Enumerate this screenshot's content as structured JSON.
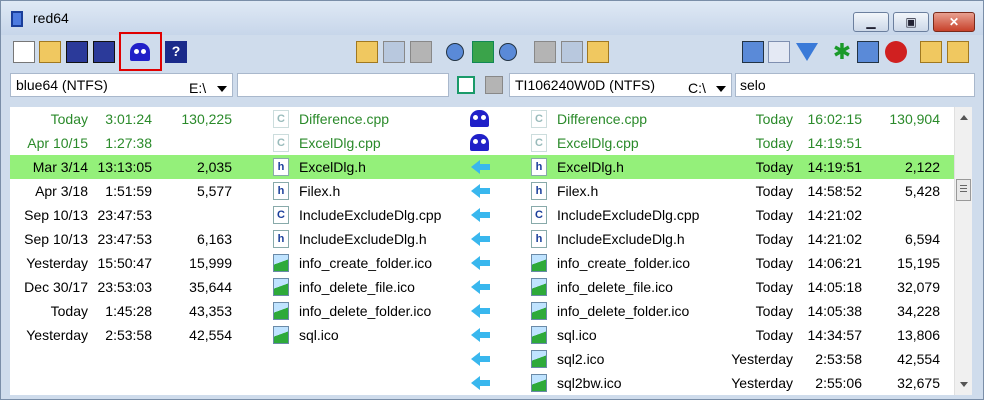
{
  "window": {
    "title": "red64"
  },
  "left_pane": {
    "label": "blue64 (NTFS)",
    "drive": "E:\\",
    "filter": ""
  },
  "right_pane": {
    "label": "TI106240W0D (NTFS)",
    "drive": "C:\\",
    "filter": "selo"
  },
  "toolbar_icons": [
    "new-document-icon",
    "open-folder-icon",
    "save-icon",
    "save-as-icon",
    "ghost-compare-icon",
    "help-icon",
    "open-left-icon",
    "copy-left-icon",
    "disabled-icon",
    "find-icon",
    "swap-icon",
    "zoom-icon",
    "disabled-icon",
    "copy-right-icon",
    "open-right-icon",
    "view-cube-icon",
    "clock-icon",
    "filter-icon",
    "asterisk-icon",
    "not-equal-icon",
    "error-icon",
    "expand-tree-icon",
    "collapse-tree-icon"
  ],
  "colors": {
    "selected_row": "#94f07a",
    "same_text": "#2a8a2a",
    "arrow": "#39b7ee",
    "ghost": "#2020c8"
  },
  "rows": [
    {
      "ldate": "Today",
      "ltime": "3:01:24",
      "lsize": "130,225",
      "lname": "Difference.cpp",
      "licon": "C",
      "action": "ghost",
      "rname": "Difference.cpp",
      "ricon": "C",
      "rdate": "Today",
      "rtime": "16:02:15",
      "rsize": "130,904",
      "status": "green"
    },
    {
      "ldate": "Apr 10/15",
      "ltime": "1:27:38",
      "lsize": "",
      "lname": "ExcelDlg.cpp",
      "licon": "C",
      "action": "ghost",
      "rname": "ExcelDlg.cpp",
      "ricon": "C",
      "rdate": "Today",
      "rtime": "14:19:51",
      "rsize": "",
      "status": "green"
    },
    {
      "ldate": "Mar 3/14",
      "ltime": "13:13:05",
      "lsize": "2,035",
      "lname": "ExcelDlg.h",
      "licon": "h",
      "action": "arrow",
      "rname": "ExcelDlg.h",
      "ricon": "h",
      "rdate": "Today",
      "rtime": "14:19:51",
      "rsize": "2,122",
      "status": "selected"
    },
    {
      "ldate": "Apr 3/18",
      "ltime": "1:51:59",
      "lsize": "5,577",
      "lname": "Filex.h",
      "licon": "h",
      "action": "arrow",
      "rname": "Filex.h",
      "ricon": "h",
      "rdate": "Today",
      "rtime": "14:58:52",
      "rsize": "5,428",
      "status": "normal"
    },
    {
      "ldate": "Sep 10/13",
      "ltime": "23:47:53",
      "lsize": "",
      "lname": "IncludeExcludeDlg.cpp",
      "licon": "C",
      "action": "arrow",
      "rname": "IncludeExcludeDlg.cpp",
      "ricon": "C",
      "rdate": "Today",
      "rtime": "14:21:02",
      "rsize": "",
      "status": "normal"
    },
    {
      "ldate": "Sep 10/13",
      "ltime": "23:47:53",
      "lsize": "6,163",
      "lname": "IncludeExcludeDlg.h",
      "licon": "h",
      "action": "arrow",
      "rname": "IncludeExcludeDlg.h",
      "ricon": "h",
      "rdate": "Today",
      "rtime": "14:21:02",
      "rsize": "6,594",
      "status": "normal"
    },
    {
      "ldate": "Yesterday",
      "ltime": "15:50:47",
      "lsize": "15,999",
      "lname": "info_create_folder.ico",
      "licon": "img",
      "action": "arrow",
      "rname": "info_create_folder.ico",
      "ricon": "img",
      "rdate": "Today",
      "rtime": "14:06:21",
      "rsize": "15,195",
      "status": "normal"
    },
    {
      "ldate": "Dec 30/17",
      "ltime": "23:53:03",
      "lsize": "35,644",
      "lname": "info_delete_file.ico",
      "licon": "img",
      "action": "arrow",
      "rname": "info_delete_file.ico",
      "ricon": "img",
      "rdate": "Today",
      "rtime": "14:05:18",
      "rsize": "32,079",
      "status": "normal"
    },
    {
      "ldate": "Today",
      "ltime": "1:45:28",
      "lsize": "43,353",
      "lname": "info_delete_folder.ico",
      "licon": "img",
      "action": "arrow",
      "rname": "info_delete_folder.ico",
      "ricon": "img",
      "rdate": "Today",
      "rtime": "14:05:38",
      "rsize": "34,228",
      "status": "normal"
    },
    {
      "ldate": "Yesterday",
      "ltime": "2:53:58",
      "lsize": "42,554",
      "lname": "sql.ico",
      "licon": "img",
      "action": "arrow",
      "rname": "sql.ico",
      "ricon": "img",
      "rdate": "Today",
      "rtime": "14:34:57",
      "rsize": "13,806",
      "status": "normal"
    },
    {
      "ldate": "",
      "ltime": "",
      "lsize": "",
      "lname": "",
      "licon": "",
      "action": "arrow",
      "rname": "sql2.ico",
      "ricon": "img",
      "rdate": "Yesterday",
      "rtime": "2:53:58",
      "rsize": "42,554",
      "status": "normal"
    },
    {
      "ldate": "",
      "ltime": "",
      "lsize": "",
      "lname": "",
      "licon": "",
      "action": "arrow",
      "rname": "sql2bw.ico",
      "ricon": "img",
      "rdate": "Yesterday",
      "rtime": "2:55:06",
      "rsize": "32,675",
      "status": "normal"
    }
  ]
}
